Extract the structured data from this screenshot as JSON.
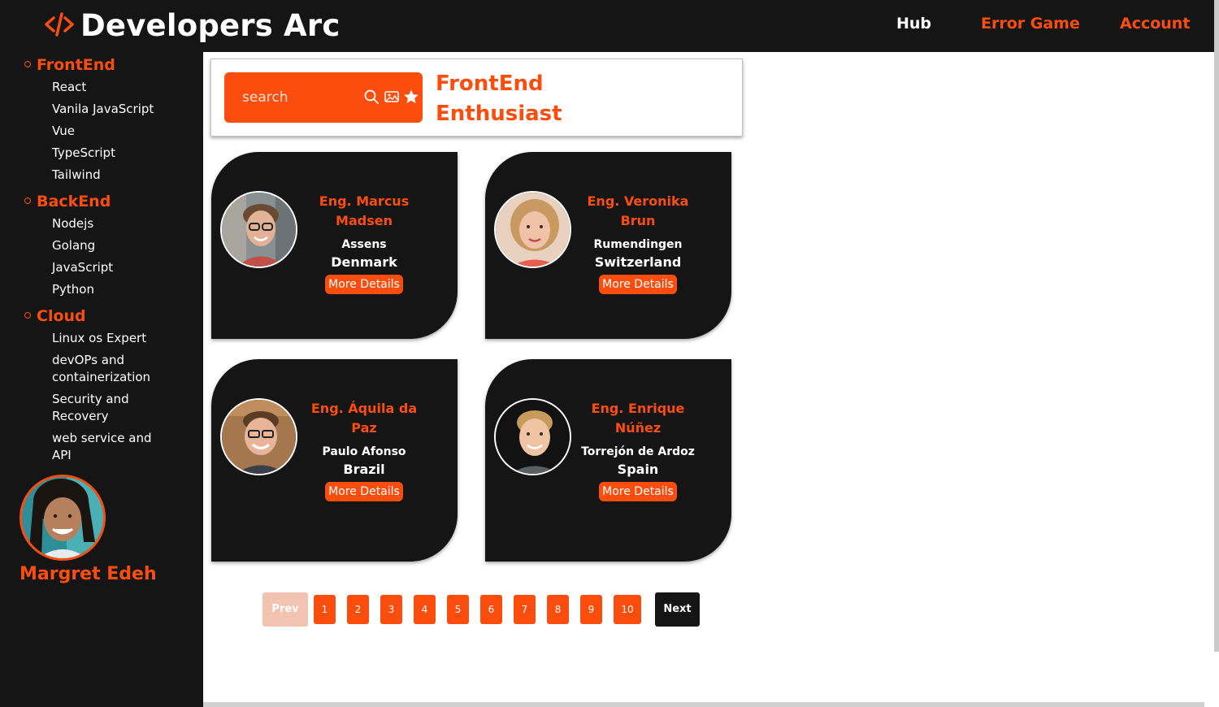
{
  "header": {
    "brand": "Developers Arc",
    "nav": [
      {
        "label": "Hub",
        "color": "#ffffff"
      },
      {
        "label": "Error Game",
        "color": "#fb4d0e"
      },
      {
        "label": "Account",
        "color": "#fb4d0e"
      }
    ]
  },
  "colors": {
    "accent": "#fb4d0e",
    "dark": "#161516"
  },
  "sidebar": {
    "categories": [
      {
        "label": "FrontEnd",
        "items": [
          "React",
          "Vanila JavaScript",
          "Vue",
          "TypeScript",
          "Tailwind"
        ]
      },
      {
        "label": "BackEnd",
        "items": [
          "Nodejs",
          "Golang",
          "JavaScript",
          "Python"
        ]
      },
      {
        "label": "Cloud",
        "items": [
          "Linux os Expert",
          "devOPs and containerization",
          "Security and Recovery",
          "web service and API"
        ]
      }
    ],
    "profile_name": "Margret Edeh"
  },
  "search": {
    "placeholder": "search",
    "icons": [
      "search-icon",
      "image-icon",
      "star-icon"
    ]
  },
  "heading": "FrontEnd Enthusiast",
  "cards": [
    {
      "name": "Eng. Marcus Madsen",
      "city": "Assens",
      "country": "Denmark",
      "button": "More Details"
    },
    {
      "name": "Eng. Veronika Brun",
      "city": "Rumendingen",
      "country": "Switzerland",
      "button": "More Details"
    },
    {
      "name": "Eng. Áquila da Paz",
      "city": "Paulo Afonso",
      "country": "Brazil",
      "button": "More Details"
    },
    {
      "name": "Eng. Enrique Núñez",
      "city": "Torrejón de Ardoz",
      "country": "Spain",
      "button": "More Details"
    }
  ],
  "pagination": {
    "prev": "Prev",
    "pages": [
      "1",
      "2",
      "3",
      "4",
      "5",
      "6",
      "7",
      "8",
      "9",
      "10"
    ],
    "next": "Next"
  }
}
